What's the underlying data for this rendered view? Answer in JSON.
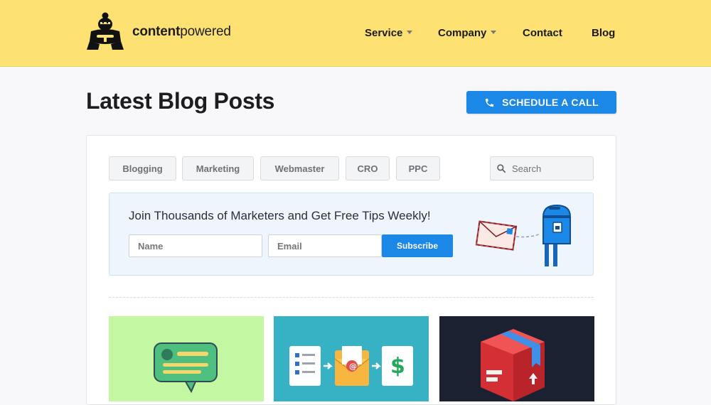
{
  "brand": {
    "name_bold": "content",
    "name_light": "powered"
  },
  "nav": {
    "items": [
      {
        "label": "Service"
      },
      {
        "label": "Company"
      },
      {
        "label": "Contact"
      },
      {
        "label": "Blog"
      }
    ]
  },
  "page": {
    "title": "Latest Blog Posts",
    "cta_label": "SCHEDULE A CALL"
  },
  "filters": {
    "categories": [
      "Blogging",
      "Marketing",
      "Webmaster",
      "CRO",
      "PPC"
    ],
    "search_placeholder": "Search"
  },
  "newsletter": {
    "title": "Join Thousands of Marketers and Get Free Tips Weekly!",
    "name_placeholder": "Name",
    "email_placeholder": "Email",
    "submit_label": "Subscribe"
  },
  "colors": {
    "header_bg": "#fde273",
    "accent": "#1b87e6",
    "thumb_1_bg": "#c4f7a1",
    "thumb_2_bg": "#37b2c4",
    "thumb_3_bg": "#1c2131"
  },
  "icons": {
    "logo": "sumo-wrestler-logo",
    "cta": "phone-icon",
    "search": "search-icon",
    "illustration": "mailbox-envelope-illustration"
  }
}
